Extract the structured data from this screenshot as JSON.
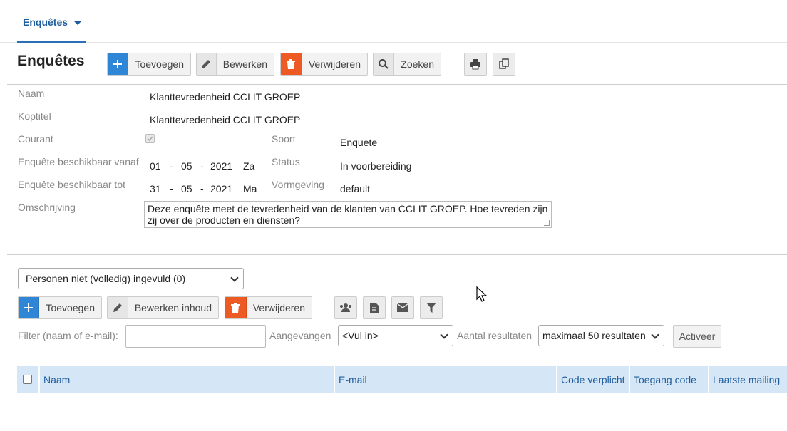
{
  "nav": {
    "tab_label": "Enquêtes"
  },
  "header": {
    "title": "Enquêtes",
    "toolbar": {
      "add_label": "Toevoegen",
      "edit_label": "Bewerken",
      "delete_label": "Verwijderen",
      "search_label": "Zoeken"
    }
  },
  "form": {
    "naam_label": "Naam",
    "naam_value": "Klanttevredenheid CCI IT GROEP",
    "koptitel_label": "Koptitel",
    "koptitel_value": "Klanttevredenheid CCI IT GROEP",
    "courant_label": "Courant",
    "soort_label": "Soort",
    "soort_value": "Enquete",
    "vanaf_label": "Enquête beschikbaar vanaf",
    "vanaf_date": {
      "day": "01",
      "month": "05",
      "year": "2021",
      "weekday": "Za"
    },
    "status_label": "Status",
    "status_value": "In voorbereiding",
    "tot_label": "Enquête beschikbaar tot",
    "tot_date": {
      "day": "31",
      "month": "05",
      "year": "2021",
      "weekday": "Ma"
    },
    "vormgeving_label": "Vormgeving",
    "vormgeving_value": "default",
    "omschrijving_label": "Omschrijving",
    "omschrijving_line1": "Deze enquête meet de tevredenheid van de klanten van CCI IT GROEP. Hoe tevreden zijn",
    "omschrijving_line2": "zij over de producten en diensten?",
    "date_sep": "-"
  },
  "persons": {
    "view_select": "Personen niet (volledig) ingevuld (0)",
    "toolbar": {
      "add_label": "Toevoegen",
      "edit_label": "Bewerken inhoud",
      "delete_label": "Verwijderen"
    },
    "filter_label": "Filter (naam of e-mail):",
    "filter_value": "",
    "aangevangen_label": "Aangevangen",
    "aangevangen_select": "<Vul in>",
    "aantal_label": "Aantal resultaten",
    "aantal_select": "maximaal 50 resultaten",
    "activeer_label": "Activeer",
    "columns": [
      "Naam",
      "E-mail",
      "Code verplicht",
      "Toegang code",
      "Laatste mailing"
    ]
  },
  "colors": {
    "accent": "#2a6fb7",
    "primary_button": "#2f86d6",
    "danger_button": "#ee5a24",
    "table_header": "#d5e6f6"
  }
}
